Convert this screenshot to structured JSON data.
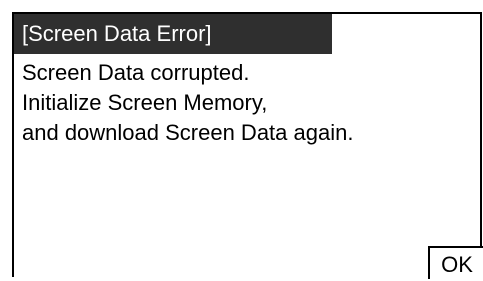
{
  "dialog": {
    "title": "[Screen Data Error]",
    "message_lines": [
      "Screen Data corrupted.",
      "Initialize Screen Memory,",
      "and download Screen Data again."
    ],
    "ok_label": "OK"
  },
  "colors": {
    "title_bar_bg": "#2f2f2f",
    "title_text": "#ffffff",
    "text": "#000000",
    "background": "#ffffff"
  }
}
